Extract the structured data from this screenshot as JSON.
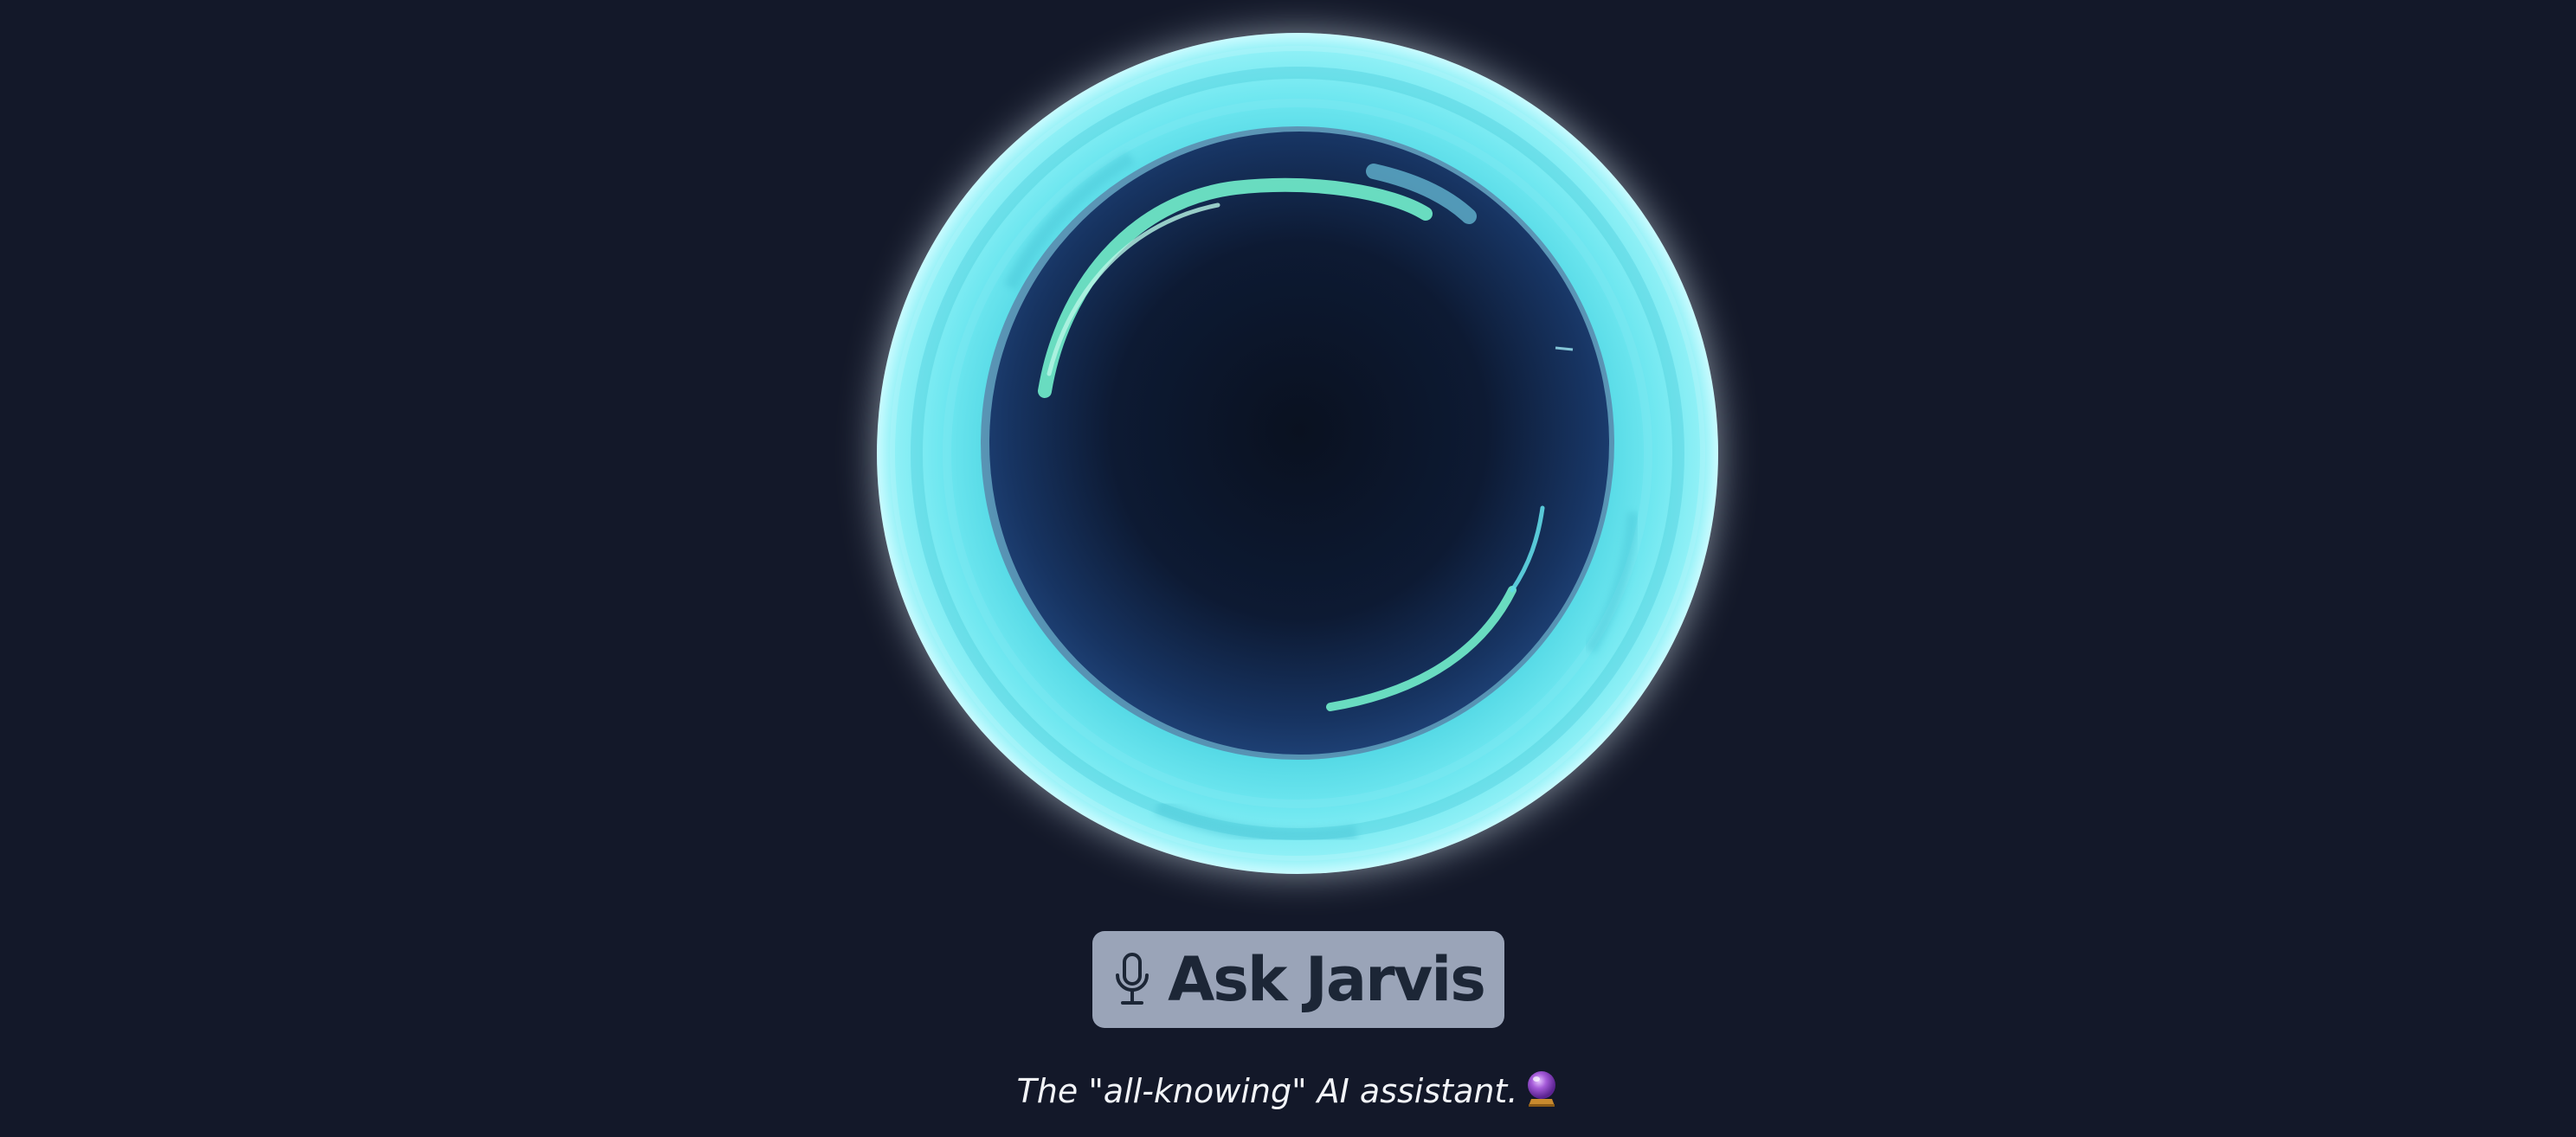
{
  "orb": {
    "icon": "glowing-ring-orb",
    "colors": {
      "background": "#131829",
      "ring": "#5fe0ea",
      "glow": "#dff6ff",
      "core_dark": "#0a1120",
      "core_edge": "#1b3b6e",
      "swirl": "#6ee6c6"
    }
  },
  "ask_button": {
    "icon": "microphone-icon",
    "label": "Ask Jarvis",
    "background": "#9aa4b8",
    "text_color": "#1c2636"
  },
  "tagline": {
    "text": "The \"all-knowing\" AI assistant.",
    "icon": "crystal-ball-icon"
  }
}
